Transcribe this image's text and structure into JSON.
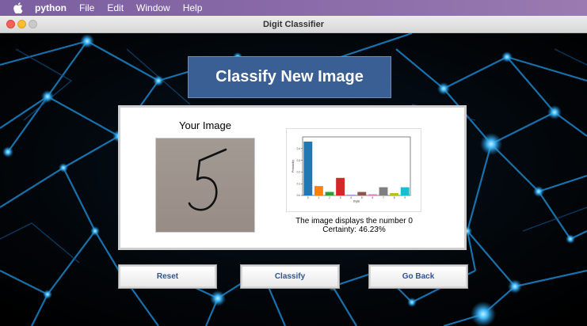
{
  "menubar": {
    "items": [
      "python",
      "File",
      "Edit",
      "Window",
      "Help"
    ],
    "icon": "apple-icon"
  },
  "window": {
    "title": "Digit Classifier"
  },
  "banner": {
    "title": "Classify New Image"
  },
  "panel": {
    "image_label": "Your Image",
    "caption_line1": "The image displays the number 0",
    "caption_line2": "Certainty: 46.23%"
  },
  "buttons": {
    "reset": "Reset",
    "classify": "Classify",
    "goback": "Go Back"
  },
  "colors": {
    "banner": "#3a5f95",
    "button_text": "#2f5496",
    "network_line": "#1b84c8",
    "network_node": "#2aa9f0"
  },
  "chart_data": {
    "type": "bar",
    "categories": [
      "0",
      "1",
      "2",
      "3",
      "4",
      "5",
      "6",
      "7",
      "8",
      "9"
    ],
    "values": [
      0.46,
      0.08,
      0.03,
      0.15,
      0.005,
      0.03,
      0.01,
      0.07,
      0.02,
      0.07
    ],
    "colors": [
      "#1f77b4",
      "#ff7f0e",
      "#2ca02c",
      "#d62728",
      "#9467bd",
      "#8c564b",
      "#e377c2",
      "#7f7f7f",
      "#bcbd22",
      "#17becf"
    ],
    "ylim": [
      0,
      0.5
    ],
    "yticks": [
      0.0,
      0.1,
      0.2,
      0.3,
      0.4
    ],
    "xlabel": "Digits",
    "ylabel": "Probability"
  }
}
